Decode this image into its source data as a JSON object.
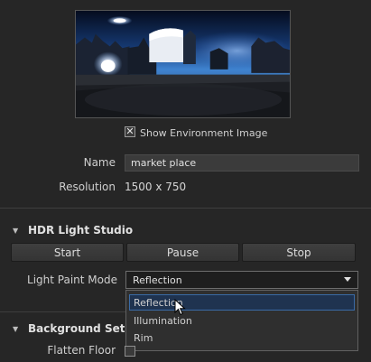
{
  "environment": {
    "show_image_label": "Show Environment Image",
    "show_image_checked": true,
    "name_label": "Name",
    "name_value": "market place",
    "resolution_label": "Resolution",
    "resolution_value": "1500 x 750"
  },
  "hdr_section": {
    "title": "HDR Light Studio",
    "buttons": {
      "start": "Start",
      "pause": "Pause",
      "stop": "Stop"
    },
    "light_paint_mode_label": "Light Paint Mode",
    "light_paint_mode_value": "Reflection",
    "options": [
      "Reflection",
      "Illumination",
      "Rim"
    ]
  },
  "background_section": {
    "title": "Background Settings",
    "flatten_floor_label": "Flatten Floor"
  },
  "icons": {
    "checkbox": "checkmark-icon",
    "expand": "triangle-down-icon",
    "dropdown": "chevron-down-icon",
    "pointer": "mouse-cursor-icon"
  }
}
